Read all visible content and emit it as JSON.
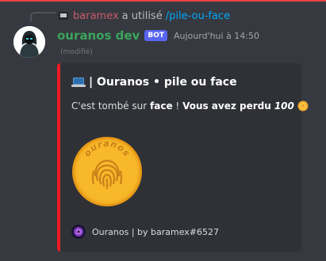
{
  "reply": {
    "username": "baramex",
    "action": "a utilisé",
    "command": "/pile-ou-face"
  },
  "message": {
    "author": "ouranos dev",
    "bot_tag": "BOT",
    "timestamp": "Aujourd'hui à 14:50",
    "edited": "(modifié)"
  },
  "embed": {
    "accent_color": "#ed1c24",
    "title": "| Ouranos • pile ou face",
    "title_icon": "laptop-icon",
    "description_prefix": "C'est tombé sur",
    "result": "face",
    "exclaim": "!",
    "lost_text": "Vous avez perdu",
    "amount": "100",
    "coin_text": "ouranos",
    "footer": "Ouranos | by baramex#6527"
  }
}
